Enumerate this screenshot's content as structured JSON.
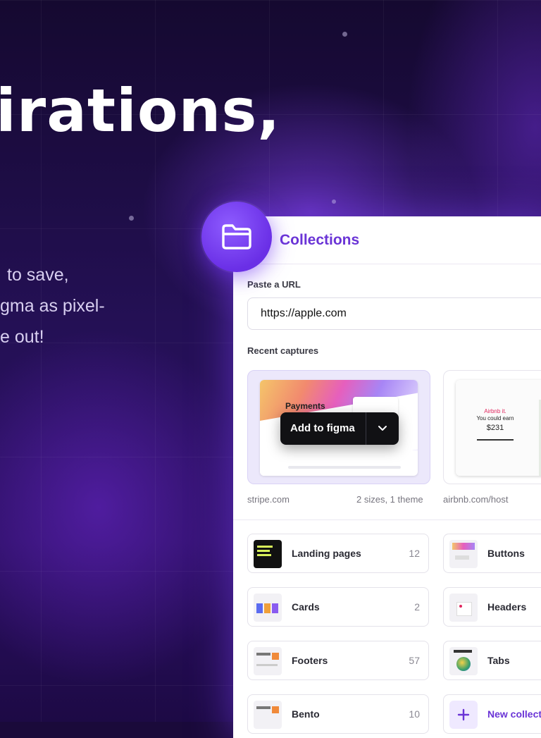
{
  "hero": {
    "title": "irations,",
    "subtitle_lines": [
      "to save,",
      "gma as pixel-",
      "e out!"
    ]
  },
  "panel": {
    "title": "Collections",
    "url_label": "Paste a URL",
    "url_value": "https://apple.com",
    "recent_label": "Recent captures",
    "captures": [
      {
        "site": "stripe.com",
        "meta": "2 sizes, 1 theme",
        "preview_heading": "Payments"
      },
      {
        "site": "airbnb.com/host",
        "preview_line1": "Airbnb it.",
        "preview_line2": "You could earn",
        "preview_price": "$231"
      }
    ],
    "add_to_figma": "Add to figma",
    "collections": [
      {
        "name": "Landing pages",
        "count": "12"
      },
      {
        "name": "Buttons"
      },
      {
        "name": "Cards",
        "count": "2"
      },
      {
        "name": "Headers"
      },
      {
        "name": "Footers",
        "count": "57"
      },
      {
        "name": "Tabs"
      },
      {
        "name": "Bento",
        "count": "10"
      }
    ],
    "new_collection": "New collecti"
  },
  "colors": {
    "accent": "#6a34d6",
    "background": "#1a0a3a",
    "badge": "#7a43f0"
  }
}
